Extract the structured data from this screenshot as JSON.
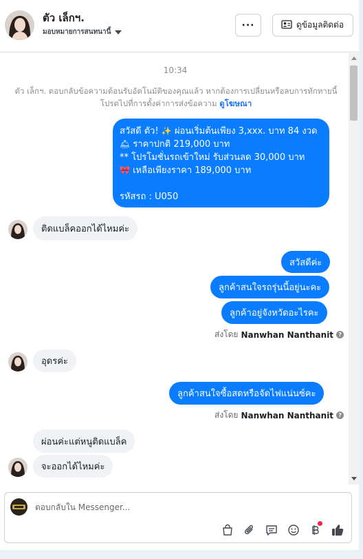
{
  "header": {
    "contact_name": "ตัว เล็กฯ.",
    "assign_label": "มอบหมายการสนทนานี้",
    "more_label": "···",
    "view_contact_label": "ดูข้อมูลติดต่อ"
  },
  "thread": {
    "timestamp": "10:34",
    "system_note": "ตัว เล็กฯ. ตอบกลับข้อความต้อนรับอัตโนมัติของคุณแล้ว หากต้องการเปลี่ยนหรือลบการทักทายนี้ โปรดไปที่การตั้งค่าการส่งข้อความ",
    "system_link": "ดูโฆษณา",
    "promo": {
      "line1": "สวัสดี ตัว!",
      "line1b": "ผ่อนเริ่มต้นเพียง 3,xxx. บาท 84 งวด",
      "line2": "ราคาปกติ 219,000 บาท",
      "line3": "** โปรโมชั่นรถเข้าใหม่ รับส่วนลด 30,000 บาท",
      "line4": "เหลือเพียงราคา 189,000 บาท",
      "line5": "รหัสรถ : U050"
    },
    "msg_in_1": "ติดแบล็คออกได้ไหมค่ะ",
    "msg_out_1": "สวัสดีค่ะ",
    "msg_out_2": "ลูกค้าสนใจรถรุ่นนี้อยู่นะคะ",
    "msg_out_3": "ลูกค้าอยู่จังหวัดอะไรคะ",
    "sent_by_label": "ส่งโดย",
    "sender_name": "Nanwhan Nanthanit",
    "msg_in_2": "อุดรค่ะ",
    "msg_out_4": "ลูกค้าสนใจซื้อสดหรือจัดไฟแน่นซ์คะ",
    "msg_in_3": "ผ่อนค่ะแต่หนูติดแบล็ค",
    "msg_in_4": "จะออกได้ไหมค่ะ"
  },
  "composer": {
    "placeholder": "ตอบกลับใน Messenger..."
  },
  "colors": {
    "outgoing": "#0a7cff",
    "incoming": "#f0f2f5",
    "link": "#1877f2"
  }
}
